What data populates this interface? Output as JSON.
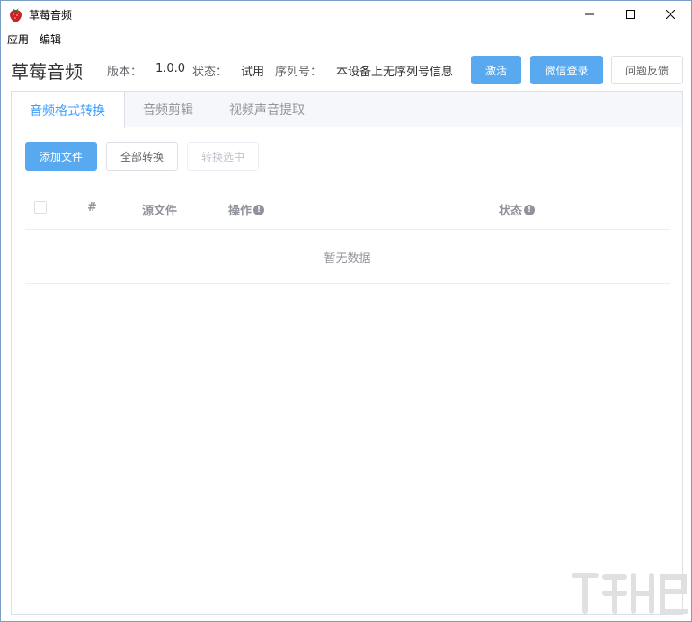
{
  "window": {
    "title": "草莓音频",
    "controls": [
      "minimize",
      "maximize",
      "close"
    ]
  },
  "menu": [
    {
      "label": "应用"
    },
    {
      "label": "编辑"
    }
  ],
  "header": {
    "app_name": "草莓音频",
    "version_label": "版本：",
    "version_value": "1.0.0",
    "status_label": "状态：",
    "status_value": "试用",
    "serial_label": "序列号：",
    "serial_value": "本设备上无序列号信息",
    "activate_button": "激活",
    "wechat_login_button": "微信登录",
    "feedback_button": "问题反馈"
  },
  "tabs": [
    {
      "label": "音频格式转换",
      "active": true
    },
    {
      "label": "音频剪辑",
      "active": false
    },
    {
      "label": "视频声音提取",
      "active": false
    }
  ],
  "toolbar": {
    "add_files": "添加文件",
    "convert_all": "全部转换",
    "convert_selected": "转换选中"
  },
  "table": {
    "columns": [
      "#",
      "源文件",
      "操作",
      "状态"
    ],
    "empty_text": "暂无数据",
    "rows": []
  },
  "colors": {
    "primary": "#58a9ef",
    "active_tab": "#409eff",
    "border": "#dcdfe6"
  },
  "icons": {
    "app": "strawberry-icon",
    "info": "info-circle-icon"
  }
}
